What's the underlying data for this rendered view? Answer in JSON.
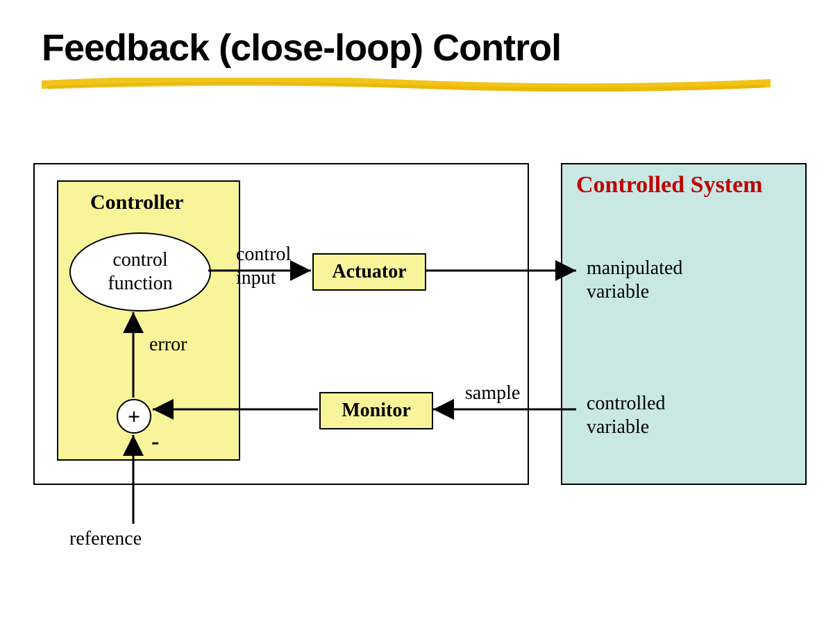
{
  "title": "Feedback (close-loop) Control",
  "controller_title": "Controller",
  "ellipse_line1": "control",
  "ellipse_line2": "function",
  "actuator": "Actuator",
  "monitor": "Monitor",
  "plus": "+",
  "minus": "-",
  "label_control_input_1": "control",
  "label_control_input_2": "input",
  "label_error": "error",
  "label_sample": "sample",
  "label_reference": "reference",
  "cs_title": "Controlled System",
  "cs_manip_1": "manipulated",
  "cs_manip_2": "variable",
  "cs_ctrl_1": "controlled",
  "cs_ctrl_2": "variable",
  "colors": {
    "yellow_fill": "#f7f49a",
    "teal_fill": "#c9e8e4",
    "underline": "#f0c419",
    "cs_title": "#c00000"
  }
}
